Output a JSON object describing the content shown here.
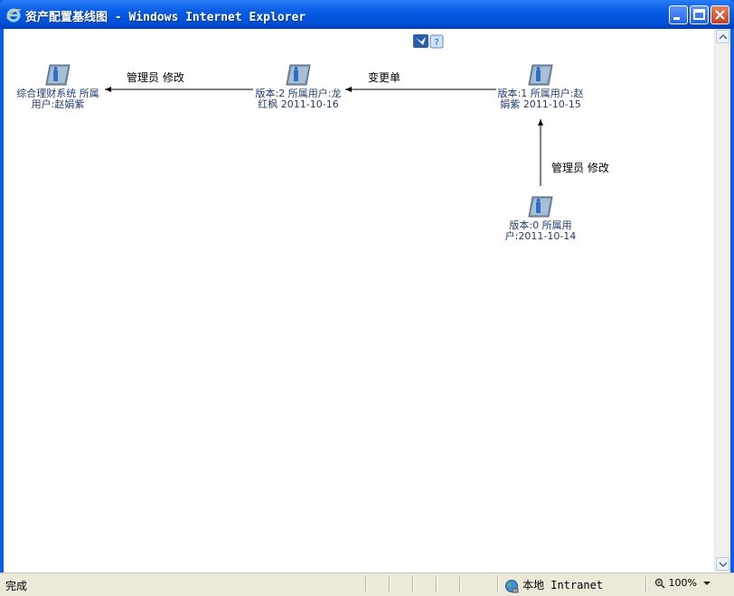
{
  "window": {
    "title": "资产配置基线图 - Windows Internet Explorer"
  },
  "nodes": [
    {
      "id": "system",
      "label": "综合理财系统 所属用户:赵娟紫"
    },
    {
      "id": "v2",
      "label": "版本:2 所属用户:龙红枫 2011-10-16"
    },
    {
      "id": "v1",
      "label": "版本:1 所属用户:赵娟紫 2011-10-15"
    },
    {
      "id": "v0",
      "label": "版本:0 所属用户:2011-10-14"
    }
  ],
  "edges": [
    {
      "label": "管理员 修改"
    },
    {
      "label": "变更单"
    },
    {
      "label": "管理员 修改"
    }
  ],
  "status": {
    "text": "完成",
    "zone": "本地 Intranet",
    "zoom": "100%"
  },
  "colors": {
    "title_bar": "#0a5fe6",
    "node_text": "#1f3d7a",
    "status_bar": "#ece9d8"
  }
}
